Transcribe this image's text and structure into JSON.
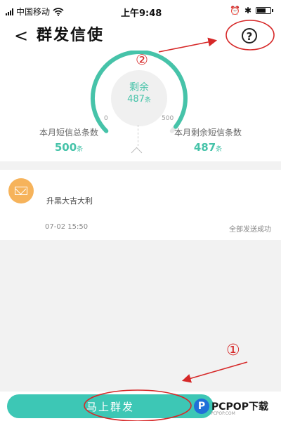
{
  "status_bar": {
    "carrier": "中国移动",
    "time": "上午9:48",
    "battery_level": 0.7
  },
  "nav": {
    "back_glyph": "<",
    "title": "群发信使",
    "help_glyph": "?"
  },
  "gauge": {
    "center_label": "剩余",
    "remaining_value": "487",
    "unit": "条",
    "min_label": "0",
    "max_label": "500",
    "fraction": 0.974
  },
  "stats": {
    "total_label": "本月短信总条数",
    "total_value": "500",
    "remaining_label": "本月剩余短信条数",
    "remaining_value": "487",
    "unit": "条"
  },
  "message": {
    "text": "升黑大吉大利",
    "time": "07-02 15:50",
    "status": "全部发送成功"
  },
  "send_button_label": "马上群发",
  "annotations": {
    "marker_1": "①",
    "marker_2": "②",
    "color": "#d62828"
  },
  "watermark": {
    "logo_letter": "P",
    "text": "PCPOP下载",
    "subtext": "PCPOP.COM"
  },
  "colors": {
    "accent": "#3dc7b5",
    "gauge_teal": "#46c3a9",
    "envelope_orange": "#f6b35b"
  }
}
